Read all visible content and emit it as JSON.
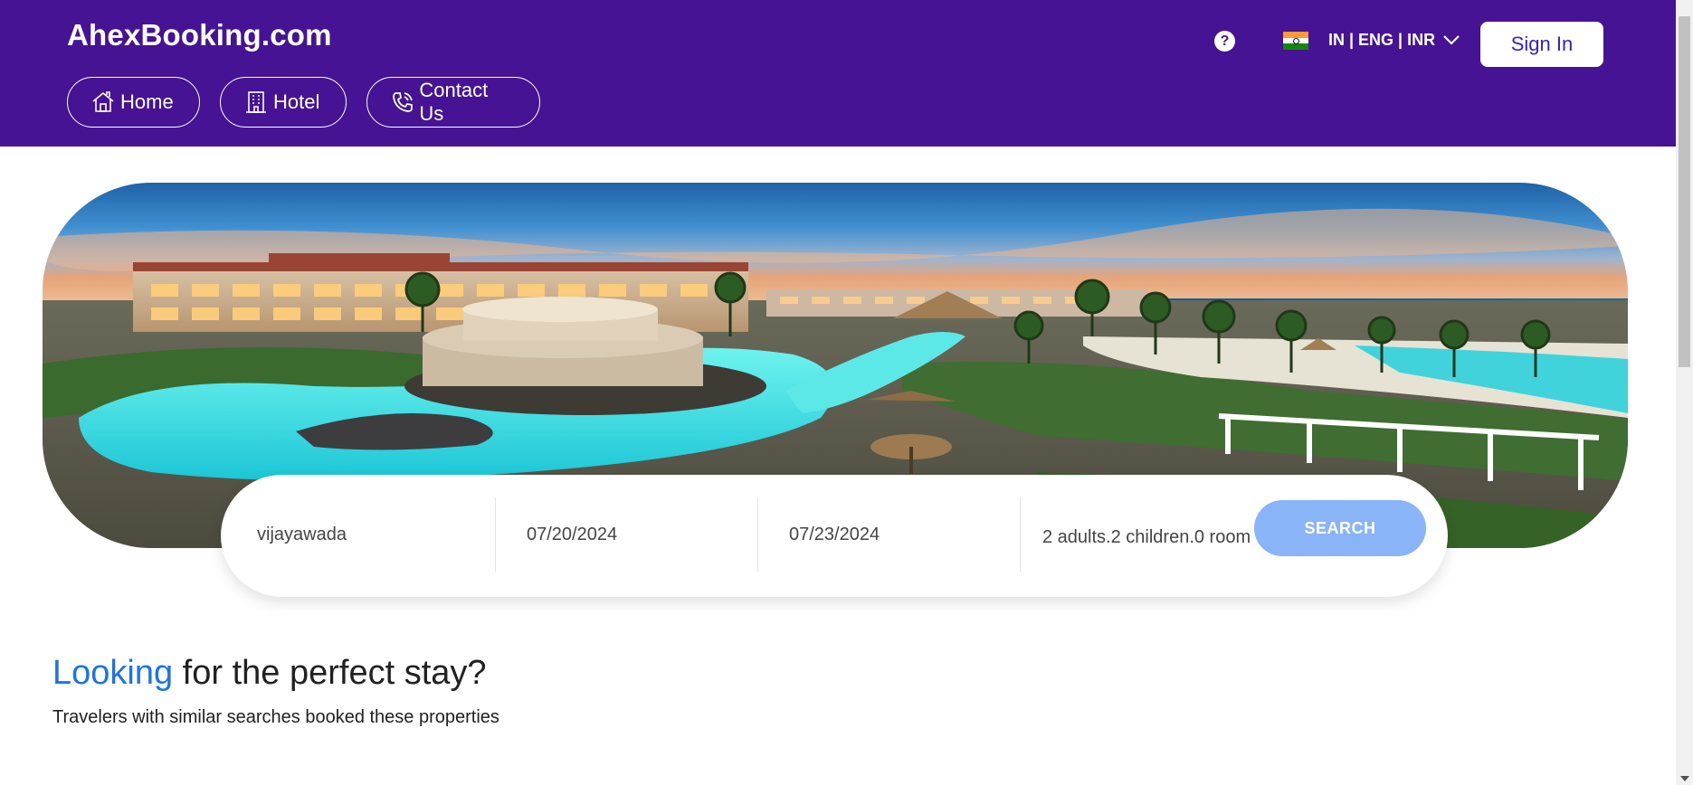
{
  "header": {
    "brand": "AhexBooking.com",
    "nav": [
      {
        "label": "Home",
        "icon": "home-icon"
      },
      {
        "label": "Hotel",
        "icon": "building-icon"
      },
      {
        "label": "Contact Us",
        "icon": "phone-icon"
      }
    ],
    "help_glyph": "?",
    "locale": "IN | ENG | INR",
    "sign_in": "Sign In"
  },
  "search": {
    "destination": "vijayawada",
    "check_in": "07/20/2024",
    "check_out": "07/23/2024",
    "guests": "2 adults.2 children.0 room",
    "button": "SEARCH"
  },
  "section": {
    "title_accent": "Looking",
    "title_rest": " for the perfect stay?",
    "subtitle": "Travelers with similar searches booked these properties"
  },
  "colors": {
    "header_bg": "#451393",
    "search_button": "#8ab4f8",
    "accent": "#1a73e8"
  }
}
